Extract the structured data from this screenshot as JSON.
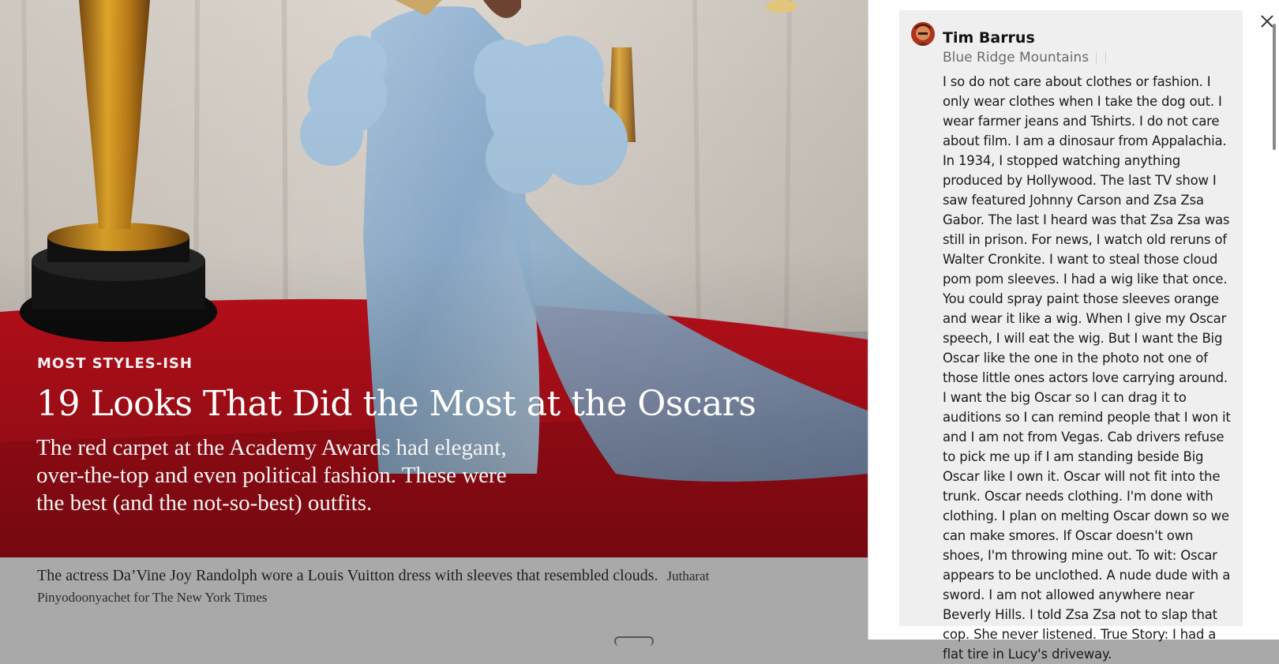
{
  "article": {
    "kicker": "MOST STYLES-ISH",
    "headline": "19 Looks That Did the Most at the Oscars",
    "summary": "The red carpet at the Academy Awards had elegant, over-the-top and even political fashion. These were the best (and the not-so-best) outfits.",
    "caption": "The actress Da’Vine Joy Randolph wore a Louis Vuitton dress with sleeves that resembled clouds.",
    "credit": "Jutharat Pinyodoonyachet for The New York Times"
  },
  "comment": {
    "author": "Tim Barrus",
    "location": "Blue Ridge Mountains",
    "body": "I so do not care about clothes or fashion. I only wear clothes when I take the dog out. I wear farmer jeans and Tshirts. I do not care about film. I am a dinosaur from Appalachia. In 1934, I stopped watching anything produced by Hollywood. The last TV show I saw featured Johnny Carson and Zsa Zsa Gabor. The last I heard was that Zsa Zsa was still in prison. For news, I watch old reruns of Walter Cronkite. I want to steal those cloud pom pom sleeves. I had a wig like that once. You could spray paint those sleeves orange and wear it like a wig. When I give my Oscar speech, I will eat the wig. But I want the Big Oscar like the one in the photo  not one of those little ones actors love carrying around. I want the big Oscar so I can drag it to auditions so I can remind people that I won it and I am not from Vegas. Cab drivers refuse to pick me up if I am standing beside Big Oscar like I own it. Oscar will not fit into the trunk. Oscar needs clothing. I'm done with clothing. I plan on melting Oscar down so we can make smores. If Oscar doesn't own shoes, I'm throwing mine out.  To wit: Oscar appears to be unclothed. A nude dude with a sword. I am not allowed anywhere near Beverly Hills. I told Zsa Zsa not to slap that cop. She never listened. True Story: I had a flat tire in Lucy's driveway."
  },
  "icons": {
    "close": "close-icon",
    "avatar": "avatar-image"
  },
  "colors": {
    "carpet": "#c4101c",
    "dress": "#9fbad6",
    "comment_bg": "#efefef",
    "page_bg": "#a9a9a9"
  }
}
